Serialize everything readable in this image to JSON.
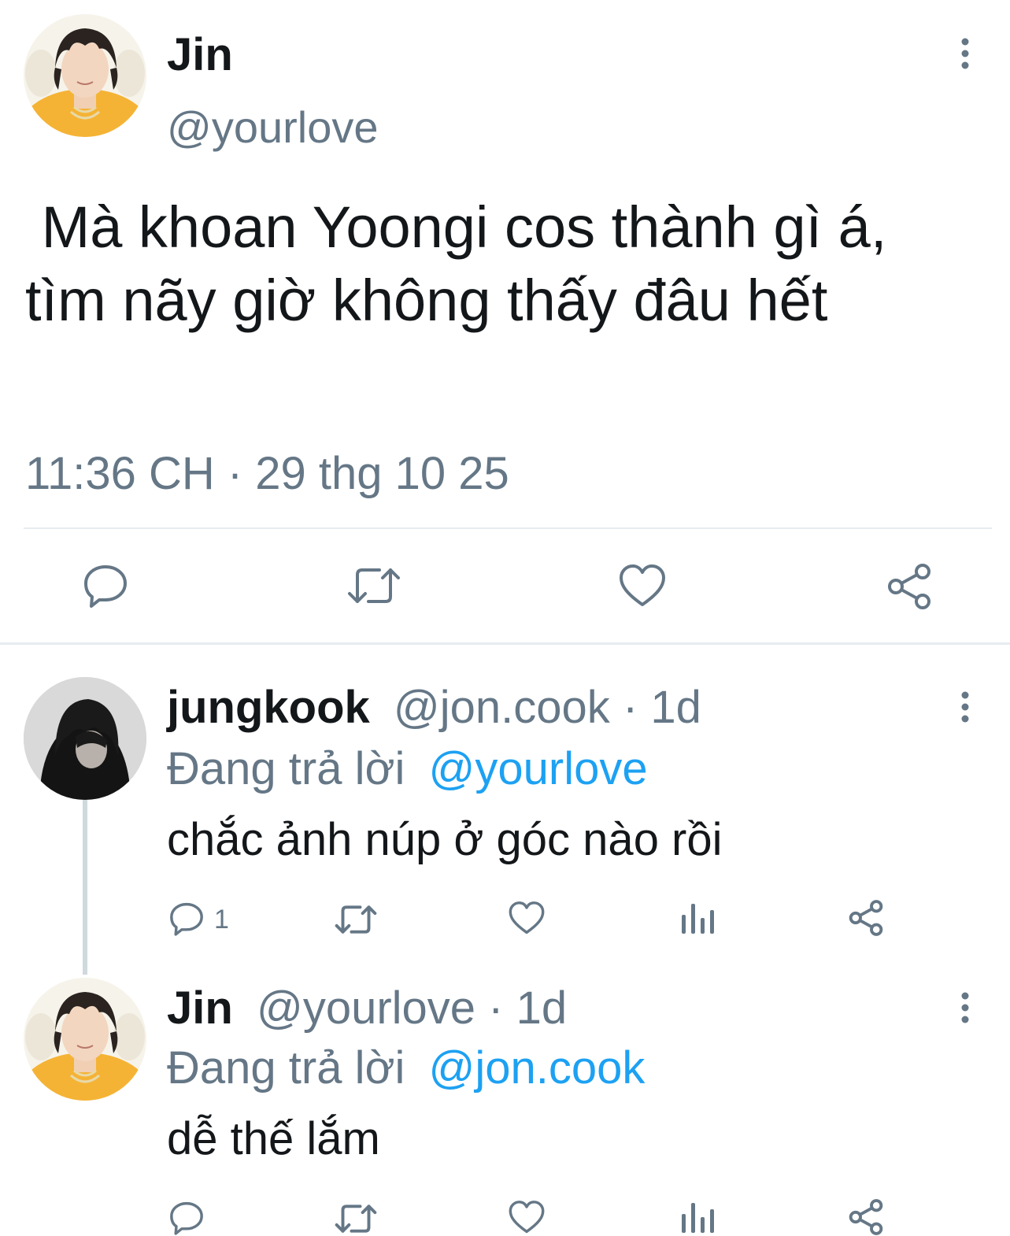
{
  "main_tweet": {
    "display_name": "Jin",
    "handle": "@yourlove",
    "text": " Mà khoan Yoongi cos thành gì á, tìm nãy giờ không thấy đâu hết",
    "timestamp": "11:36 CH · 29 thg 10 25",
    "avatar": "avatar-jin",
    "actions": [
      "reply-icon",
      "retweet-icon",
      "like-icon",
      "share-icon"
    ]
  },
  "replies": [
    {
      "display_name": "jungkook",
      "handle": "@jon.cook",
      "age": "1d",
      "separator": "·",
      "replying_prefix": "Đang trả lời",
      "replying_to": "@yourlove",
      "text": "chắc ảnh núp ở góc nào rồi",
      "reply_count": "1",
      "avatar": "avatar-jungkook"
    },
    {
      "display_name": "Jin",
      "handle": "@yourlove",
      "age": "1d",
      "separator": "·",
      "replying_prefix": "Đang trả lời",
      "replying_to": "@jon.cook",
      "text": "dễ thế lắm",
      "reply_count": "",
      "avatar": "avatar-jin"
    }
  ],
  "colors": {
    "text": "#14171a",
    "secondary": "#657786",
    "link": "#1da1f2",
    "divider": "#e6ecf0"
  }
}
